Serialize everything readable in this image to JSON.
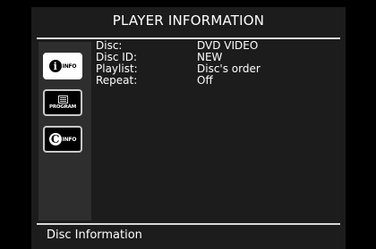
{
  "header": {
    "title": "PLAYER INFORMATION"
  },
  "sidebar": {
    "items": [
      {
        "id": "info",
        "caption": "INFO",
        "glyph": "i",
        "active": true
      },
      {
        "id": "program",
        "caption": "PROGRAM",
        "glyph": "",
        "active": false
      },
      {
        "id": "disc-info",
        "caption": "INFO",
        "glyph": "C",
        "active": false
      }
    ]
  },
  "info": {
    "rows": [
      {
        "label": "Disc:",
        "value": "DVD VIDEO"
      },
      {
        "label": "Disc ID:",
        "value": "NEW"
      },
      {
        "label": "Playlist:",
        "value": "Disc's order"
      },
      {
        "label": "Repeat:",
        "value": "Off"
      }
    ]
  },
  "status": {
    "text": "Disc Information"
  },
  "colors": {
    "background": "#1c1c1c",
    "sidebar": "#2e2e2e",
    "text": "#ffffff",
    "rule": "#d8d8d8"
  }
}
